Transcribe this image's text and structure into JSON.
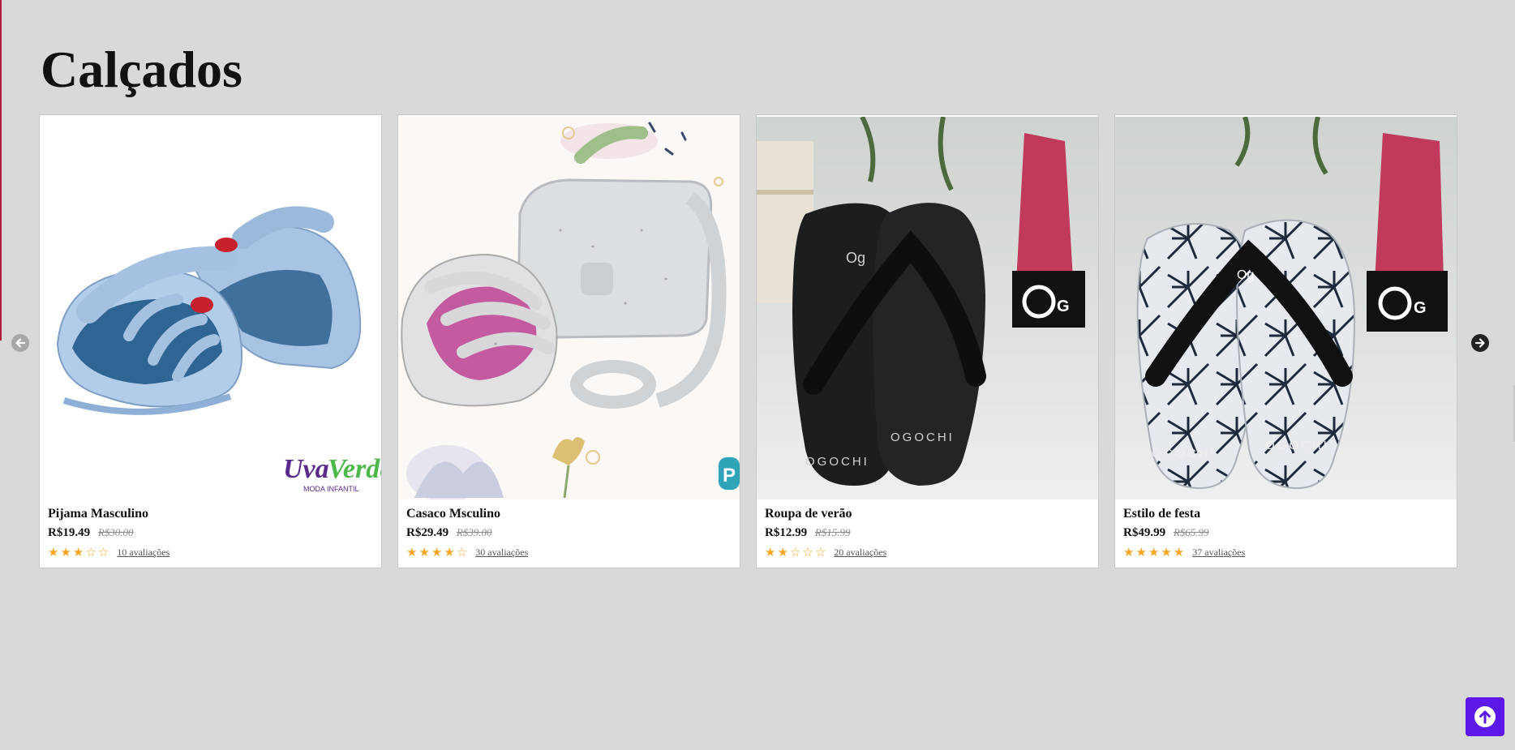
{
  "section": {
    "title": "Calçados"
  },
  "products": [
    {
      "name": "Pijama Masculino",
      "price": "R$19.49",
      "old_price": "R$30.00",
      "rating": 3,
      "reviews": "10 avaliações",
      "brand_mark": "Uva Verde",
      "brand_sub": "MODA INFANTIL"
    },
    {
      "name": "Casaco Msculino",
      "price": "R$29.49",
      "old_price": "R$39.00",
      "rating": 4,
      "reviews": "30 avaliações",
      "brand_mark": "P"
    },
    {
      "name": "Roupa de verão",
      "price": "R$12.99",
      "old_price": "R$15.99",
      "rating": 2,
      "reviews": "20 avaliações",
      "brand_mark": "OGOCHI"
    },
    {
      "name": "Estilo de festa",
      "price": "R$49.99",
      "old_price": "R$65.99",
      "rating": 5,
      "reviews": "37 avaliações",
      "brand_mark": "OGOCHI"
    }
  ],
  "icons": {
    "prev": "arrow-left-icon",
    "next": "arrow-right-icon",
    "back_to_top": "arrow-up-circle-icon"
  },
  "colors": {
    "background": "#d9d9d9",
    "star": "#f5a623",
    "back_to_top": "#5b18e8",
    "accent_left": "#b41c3c"
  }
}
